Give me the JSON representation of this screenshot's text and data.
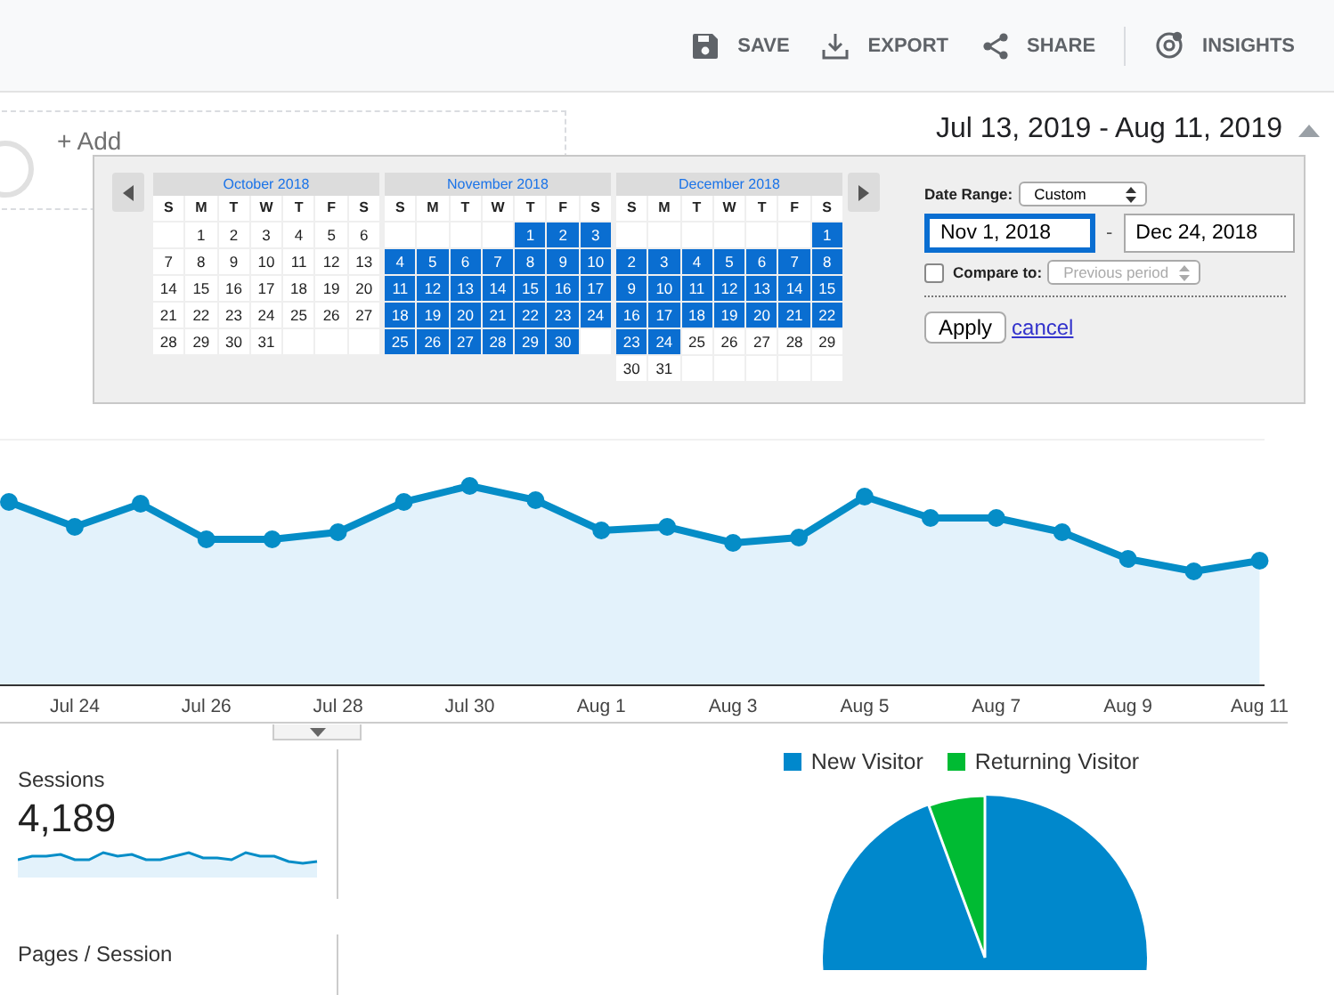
{
  "toolbar": {
    "actions": [
      {
        "label": "SAVE"
      },
      {
        "label": "EXPORT"
      },
      {
        "label": "SHARE"
      },
      {
        "label": "INSIGHTS"
      }
    ]
  },
  "segment": {
    "label": "+ Add"
  },
  "date_range": {
    "label": "Jul 13, 2019 - Aug 11, 2019",
    "expanded": true
  },
  "picker": {
    "months": [
      {
        "title": "October 2018",
        "weekdays": [
          "S",
          "M",
          "T",
          "W",
          "T",
          "F",
          "S"
        ],
        "weeks": [
          [
            {
              "label": "1",
              "selected": false
            },
            {
              "label": "2",
              "selected": false
            },
            {
              "label": "3",
              "selected": false
            },
            {
              "label": "4",
              "selected": false
            },
            {
              "label": "5",
              "selected": false
            },
            {
              "label": "6",
              "selected": false
            }
          ],
          [
            {
              "label": "7",
              "selected": false
            },
            {
              "label": "8",
              "selected": false
            },
            {
              "label": "9",
              "selected": false
            },
            {
              "label": "10",
              "selected": false
            },
            {
              "label": "11",
              "selected": false
            },
            {
              "label": "12",
              "selected": false
            },
            {
              "label": "13",
              "selected": false
            }
          ],
          [
            {
              "label": "14",
              "selected": false
            },
            {
              "label": "15",
              "selected": false
            },
            {
              "label": "16",
              "selected": false
            },
            {
              "label": "17",
              "selected": false
            },
            {
              "label": "18",
              "selected": false
            },
            {
              "label": "19",
              "selected": false
            },
            {
              "label": "20",
              "selected": false
            }
          ],
          [
            {
              "label": "21",
              "selected": false
            },
            {
              "label": "22",
              "selected": false
            },
            {
              "label": "23",
              "selected": false
            },
            {
              "label": "24",
              "selected": false
            },
            {
              "label": "25",
              "selected": false
            },
            {
              "label": "26",
              "selected": false
            },
            {
              "label": "27",
              "selected": false
            }
          ],
          [
            {
              "label": "28",
              "selected": false
            },
            {
              "label": "29",
              "selected": false
            },
            {
              "label": "30",
              "selected": false
            },
            {
              "label": "31",
              "selected": false
            }
          ]
        ]
      },
      {
        "title": "November 2018",
        "weekdays": [
          "S",
          "M",
          "T",
          "W",
          "T",
          "F",
          "S"
        ],
        "weeks": [
          [
            {
              "label": "1",
              "selected": true
            },
            {
              "label": "2",
              "selected": true
            },
            {
              "label": "3",
              "selected": true
            }
          ],
          [
            {
              "label": "4",
              "selected": true
            },
            {
              "label": "5",
              "selected": true
            },
            {
              "label": "6",
              "selected": true
            },
            {
              "label": "7",
              "selected": true
            },
            {
              "label": "8",
              "selected": true
            },
            {
              "label": "9",
              "selected": true
            },
            {
              "label": "10",
              "selected": true
            }
          ],
          [
            {
              "label": "11",
              "selected": true
            },
            {
              "label": "12",
              "selected": true
            },
            {
              "label": "13",
              "selected": true
            },
            {
              "label": "14",
              "selected": true
            },
            {
              "label": "15",
              "selected": true
            },
            {
              "label": "16",
              "selected": true
            },
            {
              "label": "17",
              "selected": true
            }
          ],
          [
            {
              "label": "18",
              "selected": true
            },
            {
              "label": "19",
              "selected": true
            },
            {
              "label": "20",
              "selected": true
            },
            {
              "label": "21",
              "selected": true
            },
            {
              "label": "22",
              "selected": true
            },
            {
              "label": "23",
              "selected": true
            },
            {
              "label": "24",
              "selected": true
            }
          ],
          [
            {
              "label": "25",
              "selected": true
            },
            {
              "label": "26",
              "selected": true
            },
            {
              "label": "27",
              "selected": true
            },
            {
              "label": "28",
              "selected": true
            },
            {
              "label": "29",
              "selected": true
            },
            {
              "label": "30",
              "selected": true
            }
          ]
        ]
      },
      {
        "title": "December 2018",
        "weekdays": [
          "S",
          "M",
          "T",
          "W",
          "T",
          "F",
          "S"
        ],
        "weeks": [
          [
            {
              "label": "1",
              "selected": true
            }
          ],
          [
            {
              "label": "2",
              "selected": true
            },
            {
              "label": "3",
              "selected": true
            },
            {
              "label": "4",
              "selected": true
            },
            {
              "label": "5",
              "selected": true
            },
            {
              "label": "6",
              "selected": true
            },
            {
              "label": "7",
              "selected": true
            },
            {
              "label": "8",
              "selected": true
            }
          ],
          [
            {
              "label": "9",
              "selected": true
            },
            {
              "label": "10",
              "selected": true
            },
            {
              "label": "11",
              "selected": true
            },
            {
              "label": "12",
              "selected": true
            },
            {
              "label": "13",
              "selected": true
            },
            {
              "label": "14",
              "selected": true
            },
            {
              "label": "15",
              "selected": true
            }
          ],
          [
            {
              "label": "16",
              "selected": true
            },
            {
              "label": "17",
              "selected": true
            },
            {
              "label": "18",
              "selected": true
            },
            {
              "label": "19",
              "selected": true
            },
            {
              "label": "20",
              "selected": true
            },
            {
              "label": "21",
              "selected": true
            },
            {
              "label": "22",
              "selected": true
            }
          ],
          [
            {
              "label": "23",
              "selected": true
            },
            {
              "label": "24",
              "selected": true
            },
            {
              "label": "25",
              "selected": false
            },
            {
              "label": "26",
              "selected": false
            },
            {
              "label": "27",
              "selected": false
            },
            {
              "label": "28",
              "selected": false
            },
            {
              "label": "29",
              "selected": false
            }
          ],
          [
            {
              "label": "30",
              "selected": false
            },
            {
              "label": "31",
              "selected": false
            }
          ]
        ]
      }
    ],
    "range_label": "Date Range:",
    "range_select": "Custom",
    "start": "Nov 1, 2018",
    "separator": "-",
    "end": "Dec 24, 2018",
    "compare": {
      "label": "Compare to:",
      "checked": false,
      "select": "Previous period"
    },
    "apply": "Apply",
    "cancel": "cancel"
  },
  "chart": {
    "x_labels": [
      "Jul 24",
      "Jul 26",
      "Jul 28",
      "Jul 30",
      "Aug 1",
      "Aug 3",
      "Aug 5",
      "Aug 7",
      "Aug 9",
      "Aug 11"
    ]
  },
  "metric": {
    "label": "Sessions",
    "value": "4,189"
  },
  "metric_2": {
    "label": "Pages / Session"
  },
  "pie": {
    "legend": [
      {
        "label": "New Visitor",
        "color": "#0088cc"
      },
      {
        "label": "Returning Visitor",
        "color": "#00bb33"
      }
    ]
  }
}
